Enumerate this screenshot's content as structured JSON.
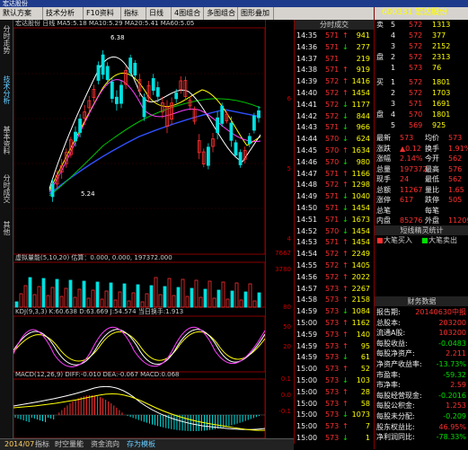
{
  "window": {
    "title": "宏达股份"
  },
  "toolbar": {
    "items": [
      "默认方案",
      "技术分析",
      "F10资料",
      "指标",
      "日线",
      "4图组合",
      "多图组合",
      "图形叠加"
    ],
    "stock_code": "600331",
    "stock_name": "宏达股份"
  },
  "left_tabs": [
    "分时走势",
    "技术分析",
    "基本资料",
    "分时成交",
    "其他"
  ],
  "kline": {
    "header": "宏达股份  日线  MA5:5.18 MA10:5.29 MA20:5.41 MA60:5.05",
    "high_label": "6.38",
    "low_label": "5.24",
    "axis_labels": [
      "6",
      "5",
      "4"
    ]
  },
  "volume": {
    "header": "虚拟量能(5,10,20)  估算：0.000, 0.000, 197372.000",
    "axis_labels": [
      "7667",
      "3780"
    ]
  },
  "kdj": {
    "header": "KDJ(9,3,3)  K:60.638  D:63.669  J:54.574  当日换手:1.913",
    "axis_labels": [
      "80",
      "50",
      "20"
    ]
  },
  "macd": {
    "header": "MACD(12,26,9)  DIFF:-0.010  DEA:-0.067  MACD:0.068",
    "axis_labels": [
      "0.1",
      "0.0",
      "-0.1"
    ]
  },
  "ticks": {
    "header": "分时成交",
    "rows": [
      [
        "14:35",
        "571",
        "↑",
        "941"
      ],
      [
        "14:36",
        "571",
        "↓",
        "277"
      ],
      [
        "14:37",
        "571",
        "",
        "219"
      ],
      [
        "14:38",
        "571",
        "↑",
        "919"
      ],
      [
        "14:39",
        "572",
        "↑",
        "1416"
      ],
      [
        "14:40",
        "572",
        "↑",
        "1454"
      ],
      [
        "14:41",
        "572",
        "↓",
        "1177"
      ],
      [
        "14:42",
        "572",
        "↓",
        "844"
      ],
      [
        "14:43",
        "571",
        "↓",
        "966"
      ],
      [
        "14:44",
        "570",
        "↓",
        "624"
      ],
      [
        "14:45",
        "570",
        "↑",
        "1634"
      ],
      [
        "14:46",
        "570",
        "↓",
        "980"
      ],
      [
        "14:47",
        "571",
        "↑",
        "1166"
      ],
      [
        "14:48",
        "572",
        "↑",
        "1298"
      ],
      [
        "14:49",
        "571",
        "↓",
        "1040"
      ],
      [
        "14:50",
        "571",
        "↓",
        "1454"
      ],
      [
        "14:51",
        "571",
        "↓",
        "1673"
      ],
      [
        "14:52",
        "570",
        "↓",
        "1454"
      ],
      [
        "14:53",
        "571",
        "↑",
        "1454"
      ],
      [
        "14:54",
        "572",
        "↑",
        "2249"
      ],
      [
        "14:55",
        "572",
        "↑",
        "1405"
      ],
      [
        "14:56",
        "572",
        "↑",
        "2022"
      ],
      [
        "14:57",
        "573",
        "↑",
        "2267"
      ],
      [
        "14:58",
        "573",
        "↑",
        "2158"
      ],
      [
        "14:59",
        "573",
        "↓",
        "1084"
      ],
      [
        "15:00",
        "573",
        "↑",
        "1162"
      ],
      [
        "14:59",
        "573",
        "↑",
        "140"
      ],
      [
        "14:59",
        "573",
        "↑",
        "95"
      ],
      [
        "14:59",
        "573",
        "↓",
        "61"
      ],
      [
        "15:00",
        "573",
        "↑",
        "52"
      ],
      [
        "15:00",
        "573",
        "↓",
        "103"
      ],
      [
        "15:00",
        "573",
        "↑",
        "28"
      ],
      [
        "15:00",
        "573",
        "↑",
        "58"
      ],
      [
        "15:00",
        "573",
        "↓",
        "1073"
      ],
      [
        "15:00",
        "573",
        "↑",
        "7"
      ],
      [
        "15:00",
        "573",
        "↓",
        "1"
      ]
    ]
  },
  "quote": {
    "title": "600331 宏达股份",
    "sell": [
      [
        "卖",
        "5",
        "572",
        "1313"
      ],
      [
        "",
        "4",
        "572",
        "377"
      ],
      [
        "",
        "3",
        "572",
        "2152"
      ],
      [
        "盘",
        "2",
        "572",
        "2313"
      ],
      [
        "",
        "1",
        "573",
        "76"
      ]
    ],
    "buy": [
      [
        "买",
        "1",
        "572",
        "1801"
      ],
      [
        "",
        "2",
        "572",
        "1703"
      ],
      [
        "",
        "3",
        "571",
        "1691"
      ],
      [
        "盘",
        "4",
        "570",
        "1801"
      ],
      [
        "",
        "5",
        "569",
        "925"
      ]
    ],
    "stats": [
      [
        "最新",
        "573",
        "均价",
        "573"
      ],
      [
        "涨跌",
        "▲0.12",
        "换手",
        "1.91%"
      ],
      [
        "涨幅",
        "2.14%",
        "今开",
        "562"
      ],
      [
        "总量",
        "197372",
        "最高",
        "576"
      ],
      [
        "现手",
        "24",
        "最低",
        "562"
      ],
      [
        "总额",
        "11267",
        "量比",
        "1.65"
      ],
      [
        "涨停",
        "617",
        "跌停",
        "505"
      ],
      [
        "总笔",
        "",
        "每笔",
        ""
      ],
      [
        "内盘",
        "85276",
        "外盘",
        "112096"
      ]
    ],
    "indicator_header": "短线精灵统计",
    "indicator_labels": [
      "大笔买入",
      "大笔卖出"
    ],
    "finance_header": "财务数据",
    "finance": [
      [
        "报告期:",
        "20140630中报"
      ],
      [
        "总股本:",
        "203200"
      ],
      [
        "流通A股:",
        "103200"
      ],
      [
        "每股收益:",
        "-0.0483"
      ],
      [
        "每股净资产:",
        "2.211"
      ],
      [
        "净资产收益率:",
        "-13.73%"
      ],
      [
        "市盈率:",
        "-59.32"
      ],
      [
        "市净率:",
        "2.59"
      ],
      [
        "每股经营现金:",
        "-0.2016"
      ],
      [
        "每股公积金:",
        "1.253"
      ],
      [
        "每股未分配:",
        "-0.209"
      ],
      [
        "股东权益比:",
        "46.95%"
      ],
      [
        "净利润同比:",
        "-78.33%"
      ]
    ]
  },
  "bottom_tabs": [
    "指标",
    "时空量能",
    "资金流向",
    "存为模板"
  ],
  "bottom_date": "2014/07",
  "colors": {
    "up": "#ff3030",
    "down": "#00e000",
    "ma_white": "#ffffff",
    "ma_yellow": "#ffff00",
    "ma_green": "#00c000",
    "ma_blue": "#3050ff",
    "panel_bg": "#000000",
    "toolbar_bg": "#d6d3ce"
  }
}
